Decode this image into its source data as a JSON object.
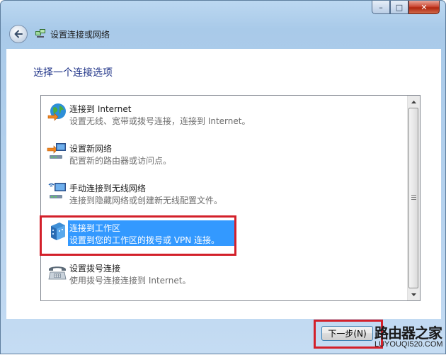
{
  "window": {
    "title": "设置连接或网络",
    "controls": {
      "minimize": "minimize-icon",
      "maximize": "maximize-icon",
      "close": "close-icon"
    }
  },
  "page": {
    "heading": "选择一个连接选项"
  },
  "options": [
    {
      "title": "连接到 Internet",
      "desc": "设置无线、宽带或拨号连接，连接到 Internet。",
      "icon": "globe-internet-icon"
    },
    {
      "title": "设置新网络",
      "desc": "配置新的路由器或访问点。",
      "icon": "new-network-icon"
    },
    {
      "title": "手动连接到无线网络",
      "desc": "连接到隐藏网络或创建新无线配置文件。",
      "icon": "wireless-network-icon"
    },
    {
      "title": "连接到工作区",
      "desc": "设置到您的工作区的拨号或 VPN 连接。",
      "icon": "workplace-icon",
      "selected": true
    },
    {
      "title": "设置拨号连接",
      "desc": "使用拨号连接连接到 Internet。",
      "icon": "dialup-phone-icon"
    }
  ],
  "buttons": {
    "next": "下一步(N)"
  },
  "watermark": {
    "main": "路由器之家",
    "sub": "LUYOUQI520.COM"
  },
  "colors": {
    "selection": "#3399ff",
    "highlight_border": "#d3202a",
    "heading": "#1e3287"
  }
}
